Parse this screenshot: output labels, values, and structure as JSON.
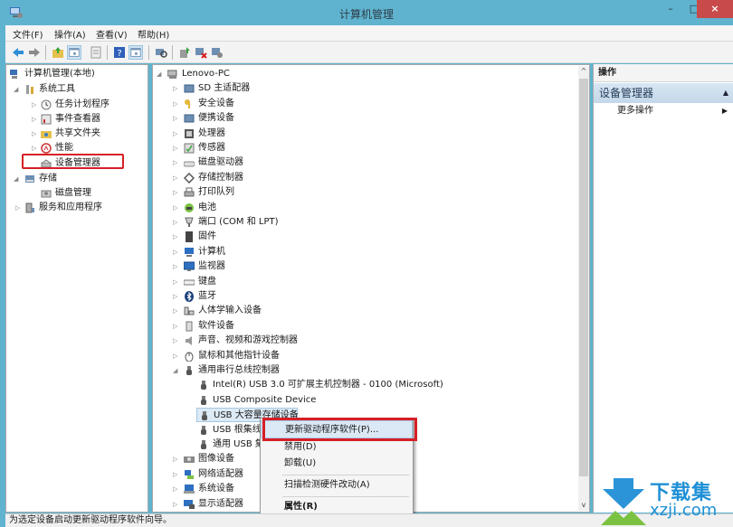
{
  "window": {
    "title": "计算机管理",
    "minimize_glyph": "–",
    "maximize_glyph": "□",
    "close_glyph": "×"
  },
  "menubar": {
    "items": [
      "文件(F)",
      "操作(A)",
      "查看(V)",
      "帮助(H)"
    ]
  },
  "toolbar": {
    "buttons": [
      "back",
      "forward",
      "up-folder",
      "show-hide-console-tree",
      "export-list",
      "help",
      "show-hide-action-pane",
      "scan-hardware",
      "update-driver",
      "uninstall-device",
      "enable-device"
    ]
  },
  "left_tree": {
    "root": "计算机管理(本地)",
    "items": [
      {
        "label": "系统工具",
        "expanded": true,
        "level": 1
      },
      {
        "label": "任务计划程序",
        "level": 2
      },
      {
        "label": "事件查看器",
        "level": 2
      },
      {
        "label": "共享文件夹",
        "level": 2
      },
      {
        "label": "性能",
        "level": 2
      },
      {
        "label": "设备管理器",
        "level": 2,
        "selected": true
      },
      {
        "label": "存储",
        "expanded": true,
        "level": 1
      },
      {
        "label": "磁盘管理",
        "level": 2
      },
      {
        "label": "服务和应用程序",
        "level": 1
      }
    ]
  },
  "device_tree": {
    "root": "Lenovo-PC",
    "categories": [
      "SD 主适配器",
      "安全设备",
      "便携设备",
      "处理器",
      "传感器",
      "磁盘驱动器",
      "存储控制器",
      "打印队列",
      "电池",
      "端口 (COM 和 LPT)",
      "固件",
      "计算机",
      "监视器",
      "键盘",
      "蓝牙",
      "人体学输入设备",
      "软件设备",
      "声音、视频和游戏控制器",
      "鼠标和其他指针设备",
      "通用串行总线控制器"
    ],
    "usb_children": [
      "Intel(R) USB 3.0 可扩展主机控制器 - 0100 (Microsoft)",
      "USB Composite Device",
      "USB 大容量存储设备",
      "USB 根集线器 (xHCI)",
      "通用 USB 集线器"
    ],
    "usb_children_visible": [
      "Intel(R) USB 3.0 可扩展主机控制器 - 0100 (Microsoft)",
      "USB Composite Device",
      "USB 大容量存储设备",
      "USB 根集线",
      "通用 USB 集"
    ],
    "after_usb": [
      "图像设备",
      "网络适配器",
      "系统设备",
      "显示适配器"
    ],
    "selected_device": "USB 大容量存储设备"
  },
  "context_menu": {
    "items": [
      {
        "label": "更新驱动程序软件(P)...",
        "highlighted": true
      },
      {
        "label": "禁用(D)"
      },
      {
        "label": "卸载(U)"
      },
      {
        "label": "扫描检测硬件改动(A)"
      },
      {
        "label": "属性(R)",
        "bold": true
      }
    ]
  },
  "actions_pane": {
    "header": "操作",
    "section": "设备管理器",
    "more_actions": "更多操作"
  },
  "statusbar": {
    "text": "为选定设备启动更新驱动程序软件向导。"
  },
  "watermark": {
    "cn": "下载集",
    "en": "xzji.com"
  },
  "colors": {
    "titlebar": "#60b3cf",
    "close_button": "#c94a4a",
    "highlight_box": "#d61f26",
    "selection": "#dceaf5",
    "watermark_blue": "#1e8fd6",
    "watermark_green": "#7cc242"
  }
}
